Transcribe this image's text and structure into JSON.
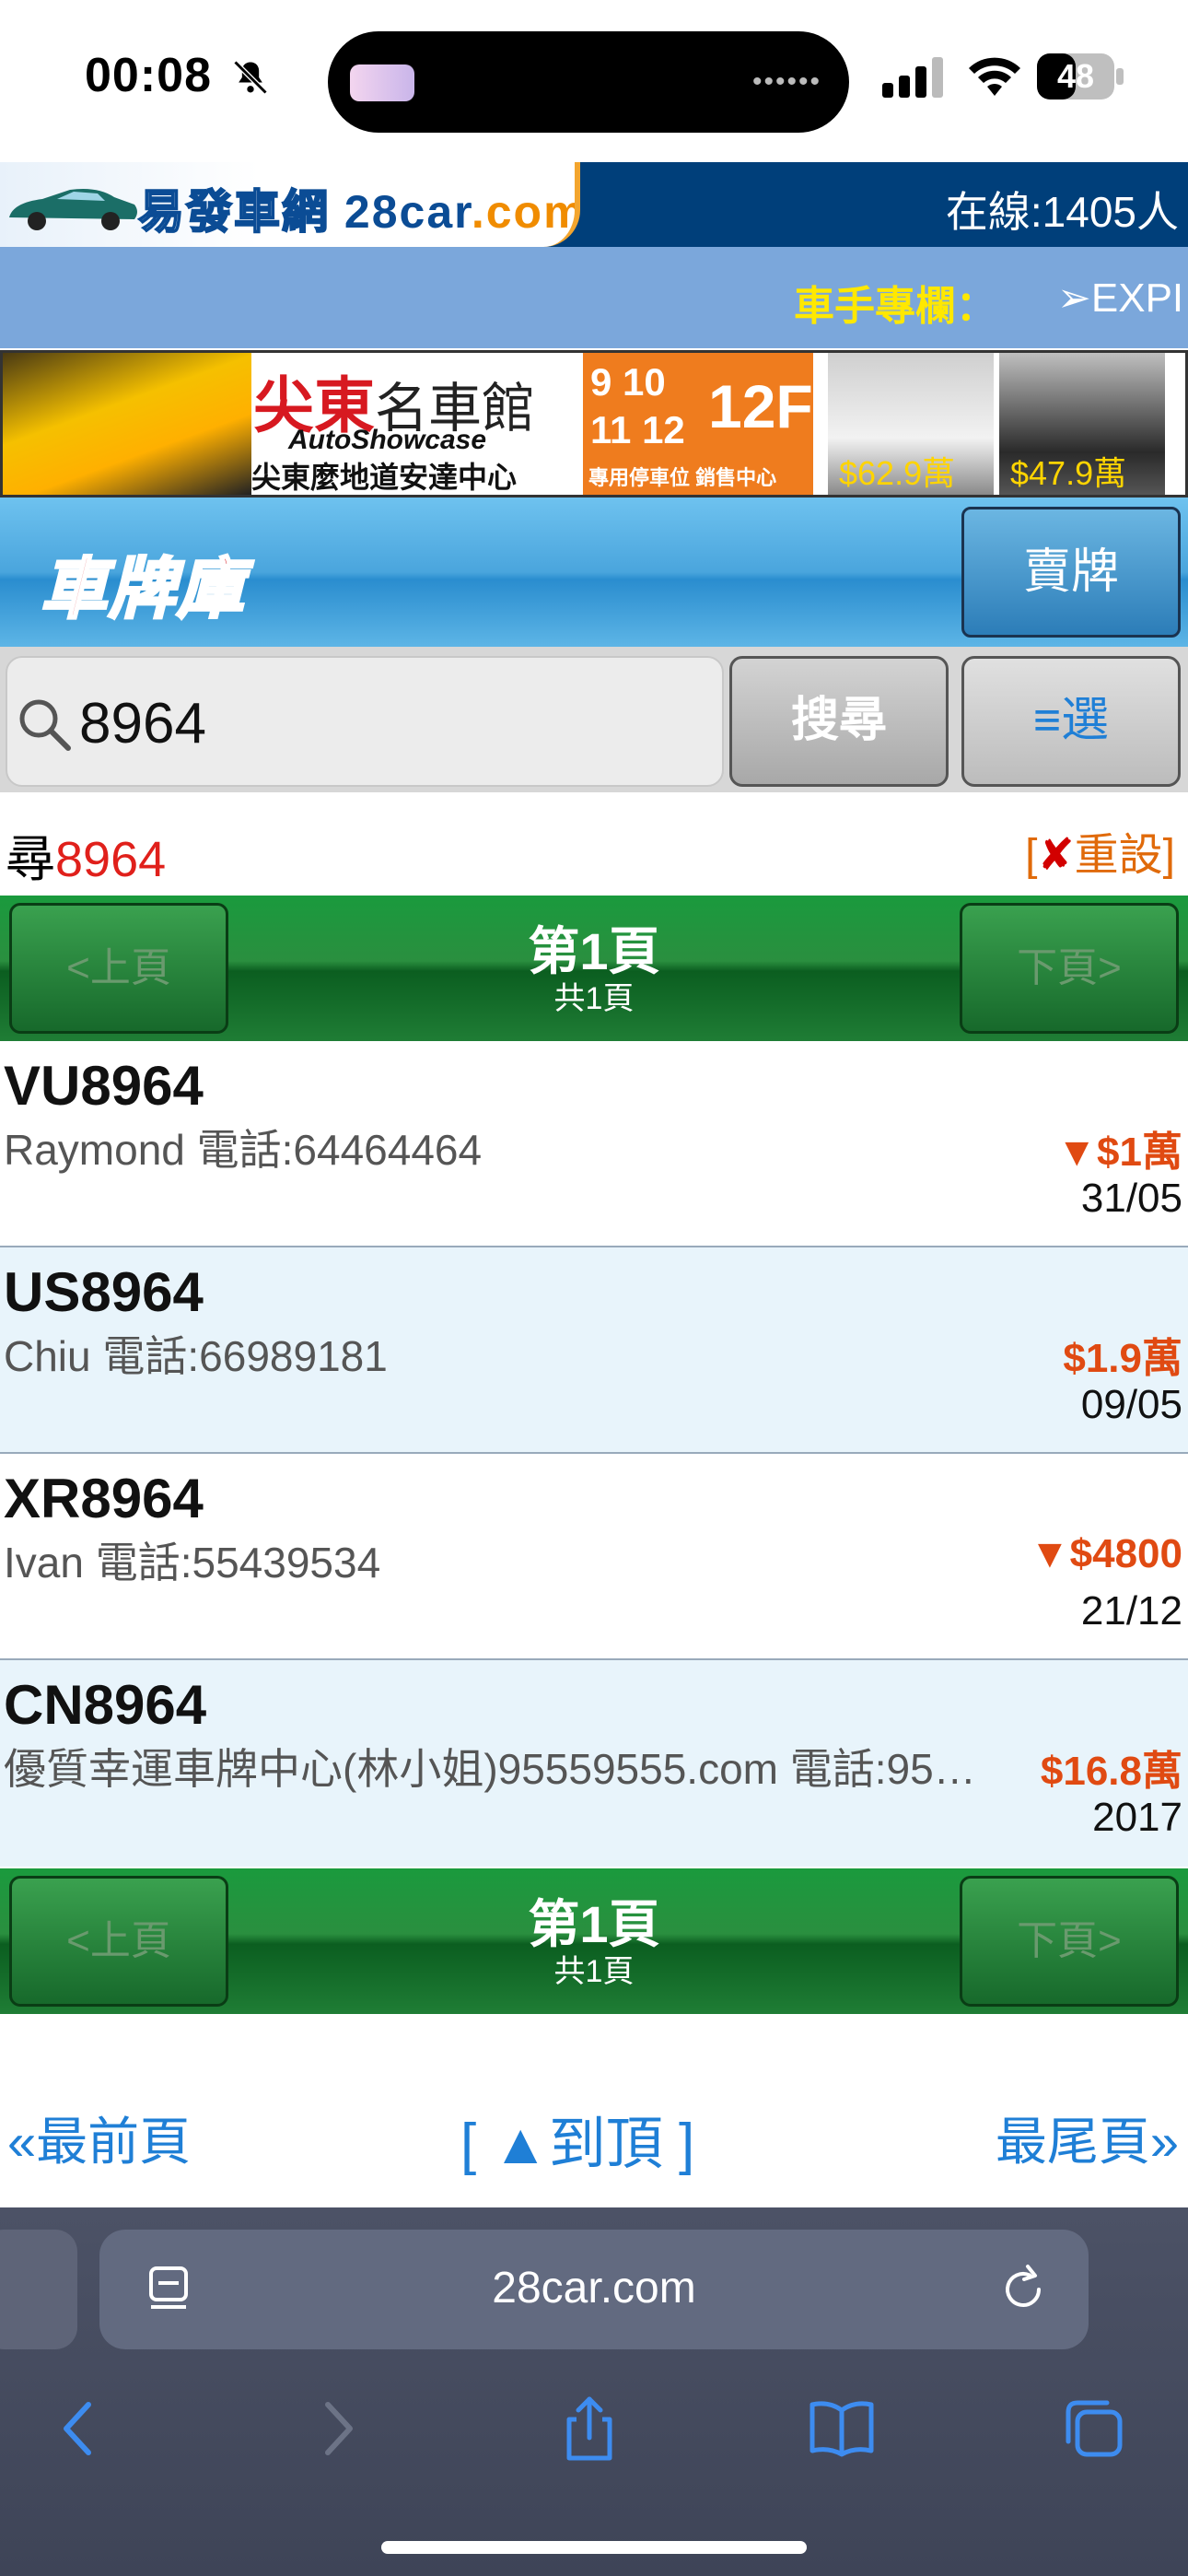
{
  "status_bar": {
    "time": "00:08",
    "battery": "48"
  },
  "header": {
    "logo_text": "易發車網",
    "logo_brand": "28car",
    "logo_domain": ".com",
    "online": "在線:1405人"
  },
  "ticker": {
    "label": "車手專欄：",
    "text": "➢EXPI"
  },
  "banner": {
    "title_red": "尖東",
    "title_black": "名車館",
    "subtitle_en": "AutoShowcase",
    "subtitle_zh": "尖東麼地道安達中心",
    "dates": "9 10\n11 12",
    "floor": "12F",
    "footer": "專用停車位 銷售中心",
    "price1": "$62.9萬",
    "price2": "$47.9萬"
  },
  "section": {
    "title": "車牌庫",
    "sell_button": "賣牌"
  },
  "search": {
    "value": "8964",
    "search_button": "搜尋",
    "select_button": "≡選"
  },
  "query": {
    "label": "尋",
    "term": "8964",
    "reset_bracket_open": "[",
    "reset_x": "✘",
    "reset_label": "重設]"
  },
  "pager": {
    "prev": "<上頁",
    "next": "下頁>",
    "page": "第1頁",
    "total": "共1頁"
  },
  "listings": [
    {
      "plate": "VU8964",
      "seller": "Raymond 電話:64464464",
      "price": "▼$1萬",
      "date": "31/05"
    },
    {
      "plate": "US8964",
      "seller": "Chiu 電話:66989181",
      "price": "$1.9萬",
      "date": "09/05"
    },
    {
      "plate": "XR8964",
      "seller": "Ivan 電話:55439534",
      "price": "▼$4800",
      "date": "21/12"
    },
    {
      "plate": "CN8964",
      "seller": "優質幸運車牌中心(林小姐)95559555.com 電話:95…",
      "price": "$16.8萬",
      "date": "2017"
    }
  ],
  "footer_nav": {
    "first": "«最前頁",
    "top": "[ ▲到頂 ]",
    "last": "最尾頁»"
  },
  "browser": {
    "url": "28car.com"
  }
}
